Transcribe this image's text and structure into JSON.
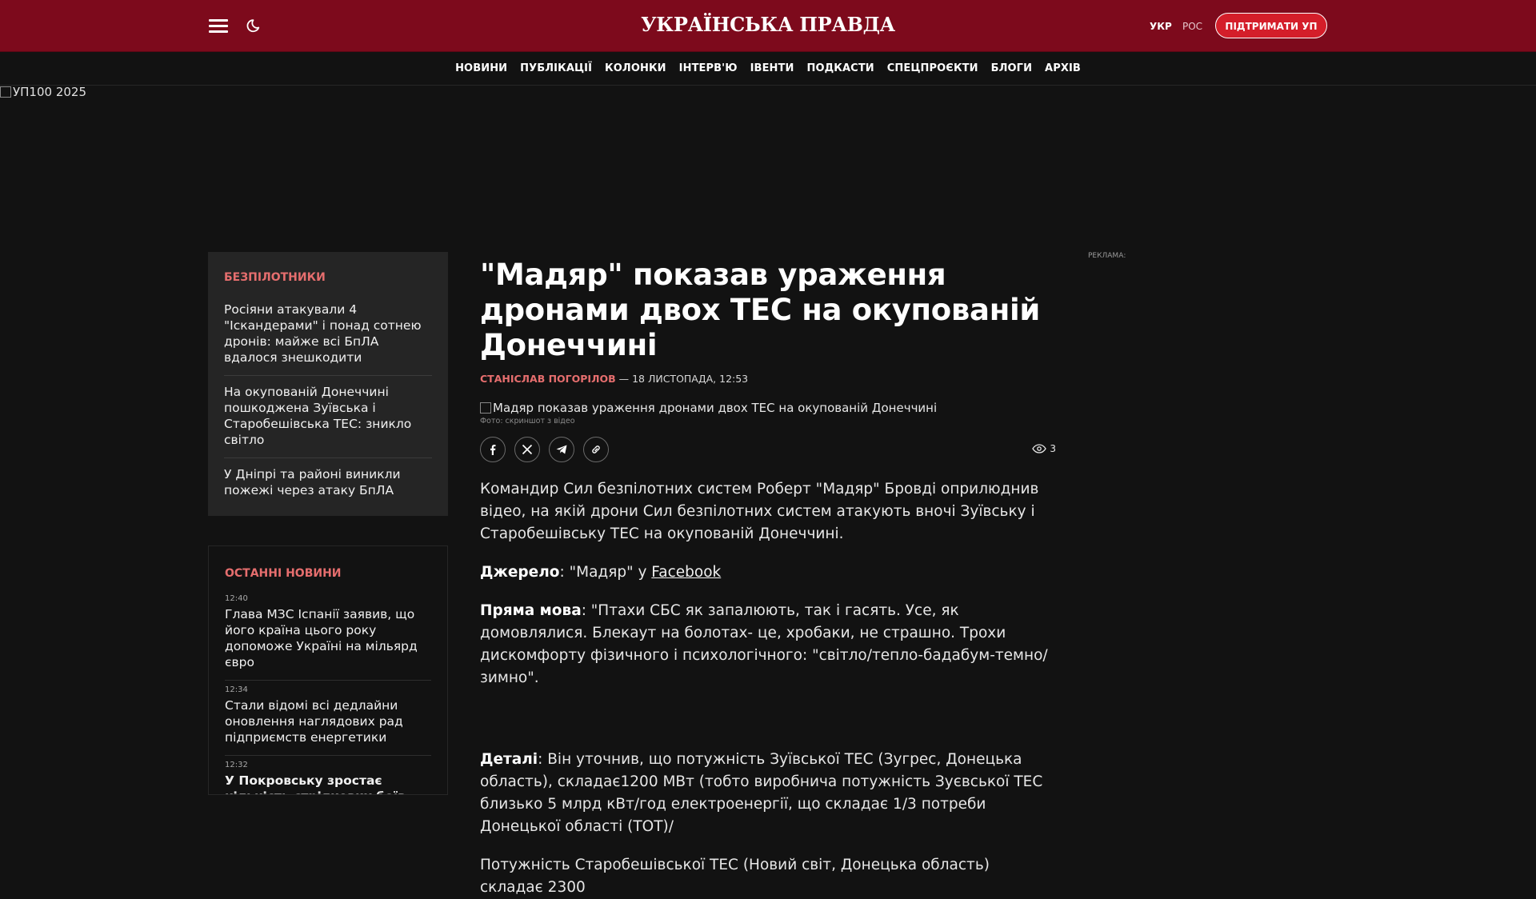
{
  "header": {
    "logo": "УКРАЇНСЬКА ПРАВДА",
    "lang_ukr": "УКР",
    "lang_ros": "РОС",
    "support": "ПІДТРИМАТИ УП"
  },
  "nav": [
    "НОВИНИ",
    "ПУБЛІКАЦІЇ",
    "КОЛОНКИ",
    "ІНТЕРВ'Ю",
    "ІВЕНТИ",
    "ПОДКАСТИ",
    "СПЕЦПРОЄКТИ",
    "БЛОГИ",
    "АРХІВ"
  ],
  "banner_alt": "УП100 2025",
  "ad_label": "РЕКЛАМА:",
  "sidebar_topic": {
    "title": "БЕЗПІЛОТНИКИ",
    "items": [
      "Росіяни атакували 4 \"Іскандерами\" і понад сотнею дронів: майже всі БпЛА вдалося знешкодити",
      "На окупованій Донеччині пошкоджена Зуївська і Старобешівська ТЕС: зникло світло",
      "У Дніпрі та районі виникли пожежі через атаку БпЛА"
    ]
  },
  "latest_news": {
    "title": "ОСТАННІ НОВИНИ",
    "items": [
      {
        "time": "12:40",
        "text": "Глава МЗС Іспанії заявив, що його країна цього року допоможе Україні на мільярд євро"
      },
      {
        "time": "12:34",
        "text": "Стали відомі всі дедлайни оновлення наглядових рад підприємств енергетики"
      },
      {
        "time": "12:32",
        "text": "У Покровську зростає кількість стрілкових боїв, ворог"
      }
    ]
  },
  "article": {
    "headline": "\"Мадяр\" показав ураження дронами двох ТЕС на окупованій Донеччині",
    "author": "СТАНІСЛАВ ПОГОРІЛОВ",
    "date": " — 18 ЛИСТОПАДА, 12:53",
    "image_alt": "Мадяр показав ураження дронами двох ТЕС на окупованій Донеччині",
    "caption": "Фото: скриншот з відео",
    "views": "3",
    "p1": "Командир Сил безпілотних систем Роберт \"Мадяр\" Бровді оприлюднив відео, на якій дрони Сил безпілотних систем атакують вночі Зуївську і Старобешівську ТЕС на окупованій Донеччині.",
    "source_label": "Джерело",
    "source_text": ": \"Мадяр\" у ",
    "source_link": "Facebook",
    "quote_label": "Пряма мова",
    "quote_text": ": \"Птахи СБС як запалюють, так і гасять. Усе, як домовлялися. Блекаут на болотах- це, хробаки, не страшно. Трохи дискомфорту фізичного і психологічного: \"світло/тепло-бадабум-темно/зимно\".",
    "details_label": "Деталі",
    "details_text": ": Він уточнив, що потужність Зуївської ТЕС (Зугрес, Донецька область), складає1200 МВт (тобто виробнича потужність Зуєвської ТЕС близько 5 млрд кВт/год електроенергії, що складає 1/3 потреби Донецької області (ТОТ)/",
    "p5": "Потужність Старобешівської ТЕС (Новий світ, Донецька область) складає 2300"
  }
}
